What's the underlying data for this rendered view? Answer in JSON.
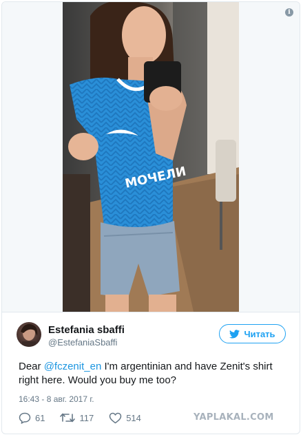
{
  "tweet": {
    "author": {
      "display_name": "Estefania sbaffi",
      "screen_name": "@EstefaniaSbaffi"
    },
    "follow_label": "Читать",
    "text_before": "Dear ",
    "mention": "@fczenit_en",
    "text_after": " I'm argentinian and have Zenit's shirt right here. Would you buy me too?",
    "timestamp": "16:43 - 8 авг. 2017 г.",
    "stats": {
      "replies": "61",
      "retweets": "117",
      "likes": "514"
    },
    "photo": {
      "shirt_text": "МОЧЕЛИ"
    }
  },
  "icons": {
    "info": "info-icon",
    "bird": "twitter-bird-icon",
    "reply": "reply-icon",
    "retweet": "retweet-icon",
    "like": "heart-icon"
  },
  "watermark": "YAPLAKAL.COM",
  "colors": {
    "twitter_blue": "#1da1f2",
    "mention": "#1b95e0",
    "muted": "#657786",
    "border": "#e1e8ed",
    "shirt": "#2a8fd8"
  }
}
